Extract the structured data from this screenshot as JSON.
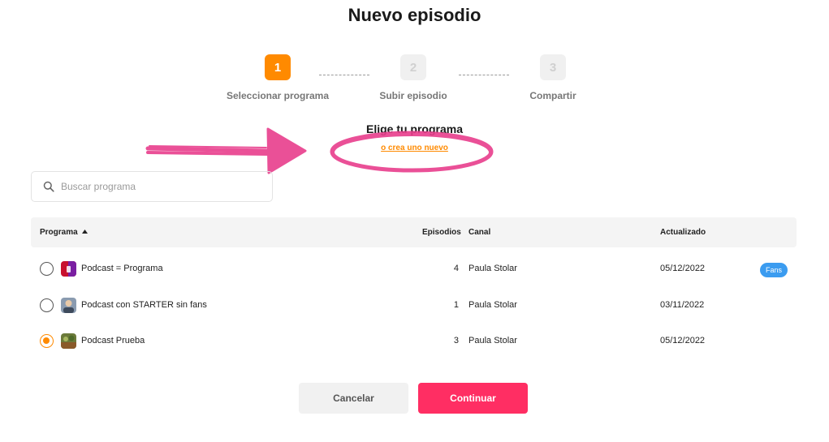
{
  "page": {
    "title": "Nuevo episodio"
  },
  "stepper": {
    "steps": [
      {
        "number": "1",
        "label": "Seleccionar programa",
        "state": "active"
      },
      {
        "number": "2",
        "label": "Subir episodio",
        "state": "inactive"
      },
      {
        "number": "3",
        "label": "Compartir",
        "state": "inactive"
      }
    ]
  },
  "chooser": {
    "title": "Elige tu programa",
    "create_link": "o crea uno nuevo"
  },
  "search": {
    "placeholder": "Buscar programa",
    "value": "",
    "icon": "search-icon"
  },
  "table": {
    "headers": {
      "programa": "Programa",
      "episodios": "Episodios",
      "canal": "Canal",
      "actualizado": "Actualizado"
    },
    "sort": {
      "column": "programa",
      "direction": "asc",
      "icon": "sort-up-icon"
    },
    "rows": [
      {
        "name": "Podcast = Programa",
        "episodes": "4",
        "channel": "Paula Stolar",
        "updated": "05/12/2022",
        "badge": "Fans",
        "selected": false,
        "thumb_color": "#c8102e"
      },
      {
        "name": "Podcast con STARTER sin fans",
        "episodes": "1",
        "channel": "Paula Stolar",
        "updated": "03/11/2022",
        "badge": "",
        "selected": false,
        "thumb_color": "#6b7a8f"
      },
      {
        "name": "Podcast Prueba",
        "episodes": "3",
        "channel": "Paula Stolar",
        "updated": "05/12/2022",
        "badge": "",
        "selected": true,
        "thumb_color": "#7a6a3a"
      }
    ]
  },
  "actions": {
    "cancel": "Cancelar",
    "continue": "Continuar"
  },
  "colors": {
    "accent": "#ff8a00",
    "primary_button": "#ff2e63",
    "badge": "#3b9cf0",
    "annotation": "#e83e8c"
  }
}
